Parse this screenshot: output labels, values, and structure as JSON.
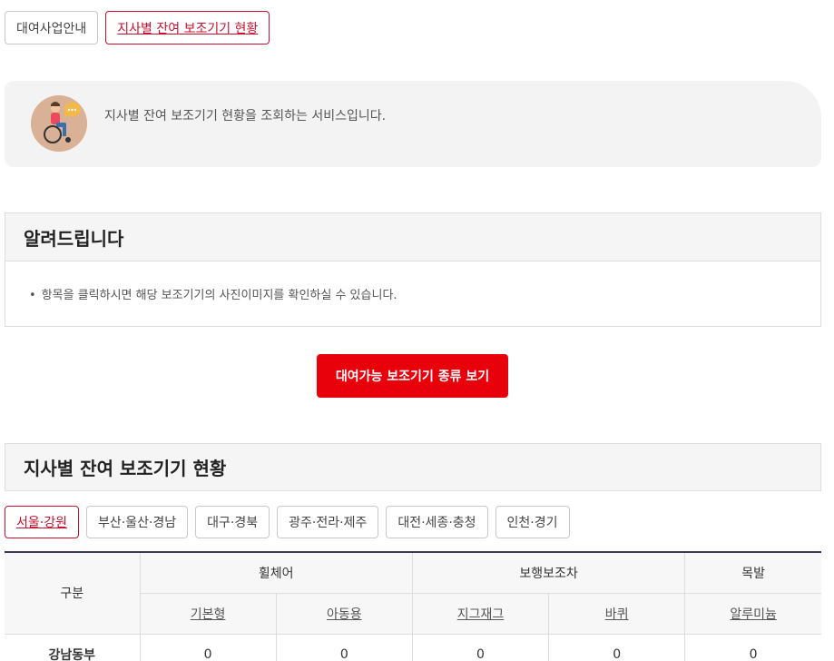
{
  "top_tabs": [
    {
      "label": "대여사업안내",
      "active": false
    },
    {
      "label": "지사별 잔여 보조기기 현황",
      "active": true
    }
  ],
  "intro": {
    "icon": "wheelchair-user-icon",
    "text": "지사별 잔여 보조기기 현황을 조회하는 서비스입니다."
  },
  "notice": {
    "title": "알려드립니다",
    "items": [
      "항목을 클릭하시면 해당 보조기기의 사진이미지를 확인하실 수 있습니다."
    ]
  },
  "cta": {
    "label": "대여가능 보조기기 종류 보기"
  },
  "section": {
    "title": "지사별 잔여 보조기기 현황"
  },
  "region_tabs": [
    {
      "label": "서울·강원",
      "active": true
    },
    {
      "label": "부산·울산·경남",
      "active": false
    },
    {
      "label": "대구·경북",
      "active": false
    },
    {
      "label": "광주·전라·제주",
      "active": false
    },
    {
      "label": "대전·세종·충청",
      "active": false
    },
    {
      "label": "인천·경기",
      "active": false
    }
  ],
  "table": {
    "row_header": "구분",
    "groups": [
      {
        "label": "휠체어",
        "items": [
          "기본형",
          "아동용"
        ]
      },
      {
        "label": "보행보조차",
        "items": [
          "지그재그",
          "바퀴"
        ]
      },
      {
        "label": "목발",
        "items": [
          "알루미늄"
        ]
      }
    ],
    "rows": [
      {
        "name": "강남동부",
        "values": [
          "0",
          "0",
          "0",
          "0",
          "0"
        ]
      }
    ]
  },
  "colors": {
    "accent": "#c8102e",
    "cta": "#e8000b",
    "table_top": "#3a3a5e"
  }
}
